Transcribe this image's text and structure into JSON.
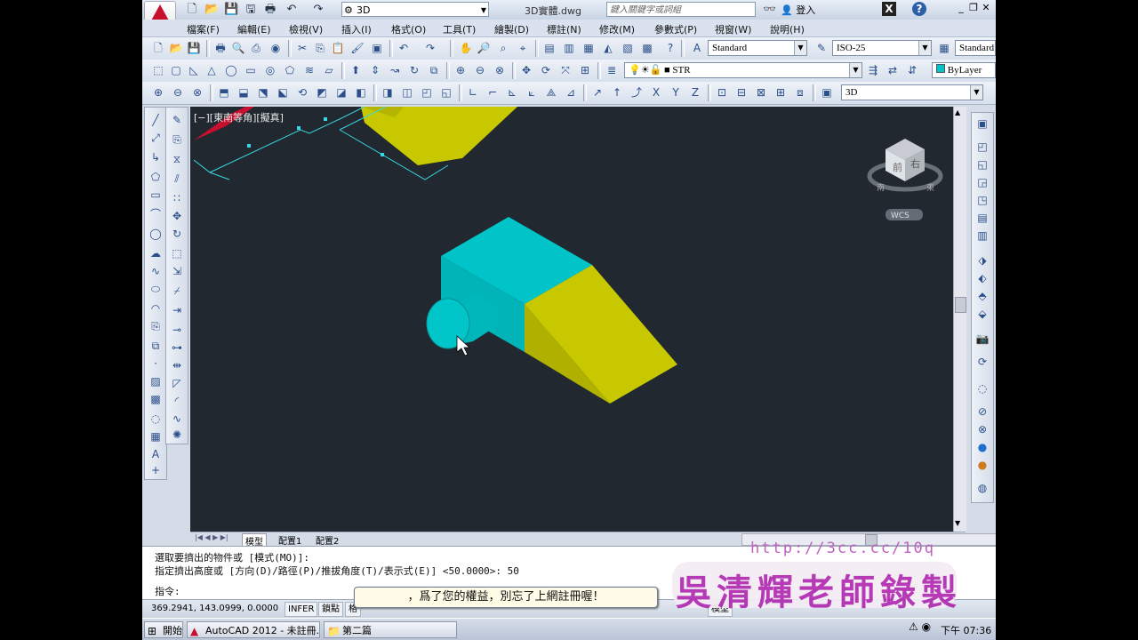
{
  "window": {
    "app_name": "AutoCAD 2012",
    "doc_title": "3D實體.dwg",
    "workspace": "3D",
    "search_placeholder": "鍵入關鍵字或詞組",
    "login": "登入"
  },
  "menubar": {
    "items": [
      "檔案(F)",
      "編輯(E)",
      "檢視(V)",
      "插入(I)",
      "格式(O)",
      "工具(T)",
      "繪製(D)",
      "標註(N)",
      "修改(M)",
      "參數式(P)",
      "視窗(W)",
      "說明(H)"
    ]
  },
  "toolbars": {
    "text_style": "Standard",
    "dim_style": "ISO-25",
    "table_style": "Standard",
    "layer": "STR",
    "color": "ByLayer",
    "view": "3D"
  },
  "viewport": {
    "label": "[−][東南等角][擬真]",
    "viewcube_faces": [
      "前",
      "右"
    ],
    "viewcube_compass": [
      "南",
      "東"
    ],
    "ucs_badge": "WCS"
  },
  "layout_tabs": [
    "模型",
    "配置1",
    "配置2"
  ],
  "command": {
    "lines": [
      "選取要擠出的物件或 [模式(MO)]:",
      "指定擠出高度或 [方向(D)/路徑(P)/推拔角度(T)/表示式(E)] <50.0000>: 50",
      "指令:"
    ]
  },
  "status": {
    "coords": "369.2941, 143.0999, 0.0000",
    "buttons": [
      "INFER",
      "鎖點",
      "格"
    ],
    "model_label": "模型"
  },
  "balloon": "，爲了您的權益，別忘了上網註冊喔！",
  "watermark": {
    "url": "http://3cc.cc/10q",
    "author": "吳清輝老師錄製"
  },
  "taskbar": {
    "start": "開始",
    "tasks": [
      "AutoCAD 2012 - 未註冊...",
      "第二篇"
    ],
    "time": "下午 07:36"
  },
  "colors": {
    "viewport_bg": "#212830",
    "solid_cyan": "#00c4c8",
    "solid_yellow": "#c8c800"
  }
}
